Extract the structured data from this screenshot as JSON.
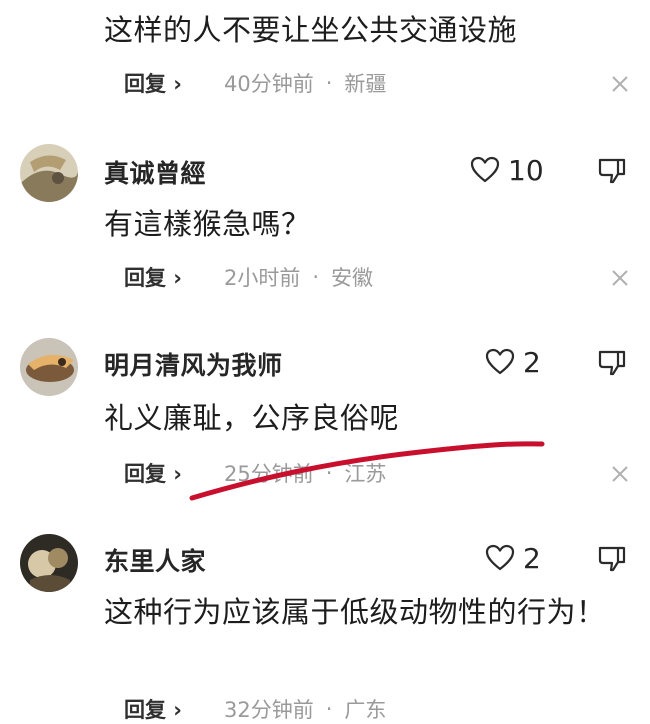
{
  "comments": [
    {
      "username": "",
      "content": "这样的人不要让坐公共交通设施",
      "likes": "",
      "reply_label": "回复 ›",
      "time": "40分钟前",
      "location": "新疆"
    },
    {
      "username": "真诚曾經",
      "content": "有這樣猴急嗎？",
      "likes": "10",
      "reply_label": "回复 ›",
      "time": "2小时前",
      "location": "安徽"
    },
    {
      "username": "明月清风为我师",
      "content": "礼义廉耻，公序良俗呢",
      "likes": "2",
      "reply_label": "回复 ›",
      "time": "25分钟前",
      "location": "江苏"
    },
    {
      "username": "东里人家",
      "content": "这种行为应该属于低级动物性的行为！",
      "likes": "2",
      "reply_label": "回复 ›",
      "time": "32分钟前",
      "location": "广东"
    }
  ],
  "separator": "·",
  "colors": {
    "annotation_stroke": "#c8102e",
    "meta_gray": "#9a9a9a",
    "text_dark": "#1d1d1d"
  },
  "icons": {
    "like": "heart-outline-icon",
    "dislike": "thumbs-down-icon",
    "close": "close-icon"
  }
}
